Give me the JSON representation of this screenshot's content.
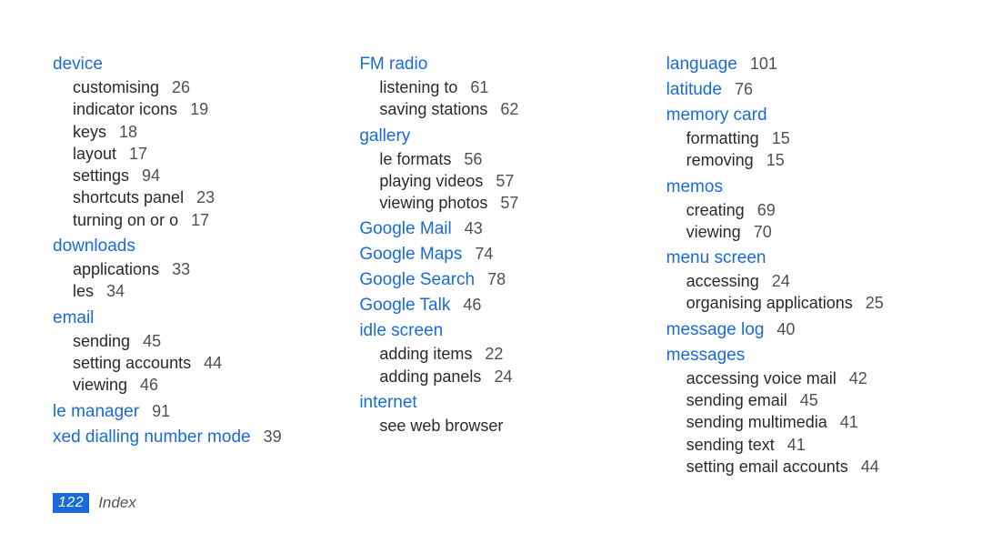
{
  "footer": {
    "page": "122",
    "label": "Index"
  },
  "columns": [
    {
      "entries": [
        {
          "heading": "device",
          "page": null,
          "sub": [
            {
              "label": "customising",
              "page": "26"
            },
            {
              "label": "indicator icons",
              "page": "19"
            },
            {
              "label": "keys",
              "page": "18"
            },
            {
              "label": "layout",
              "page": "17"
            },
            {
              "label": "settings",
              "page": "94"
            },
            {
              "label": "shortcuts panel",
              "page": "23"
            },
            {
              "label": "turning on or o",
              "page": "17"
            }
          ]
        },
        {
          "heading": "downloads",
          "page": null,
          "sub": [
            {
              "label": "applications",
              "page": "33"
            },
            {
              "label": "les",
              "page": "34"
            }
          ]
        },
        {
          "heading": "email",
          "page": null,
          "sub": [
            {
              "label": "sending",
              "page": "45"
            },
            {
              "label": "setting accounts",
              "page": "44"
            },
            {
              "label": "viewing",
              "page": "46"
            }
          ]
        },
        {
          "heading": "le manager",
          "page": "91",
          "sub": []
        },
        {
          "heading": "xed dialling number mode",
          "page": "39",
          "sub": []
        }
      ]
    },
    {
      "entries": [
        {
          "heading": "FM radio",
          "page": null,
          "sub": [
            {
              "label": "listening to",
              "page": "61"
            },
            {
              "label": "saving stations",
              "page": "62"
            }
          ]
        },
        {
          "heading": "gallery",
          "page": null,
          "sub": [
            {
              "label": "le formats",
              "page": "56"
            },
            {
              "label": "playing videos",
              "page": "57"
            },
            {
              "label": "viewing photos",
              "page": "57"
            }
          ]
        },
        {
          "heading": "Google Mail",
          "page": "43",
          "sub": []
        },
        {
          "heading": "Google Maps",
          "page": "74",
          "sub": []
        },
        {
          "heading": "Google Search",
          "page": "78",
          "sub": []
        },
        {
          "heading": "Google Talk",
          "page": "46",
          "sub": []
        },
        {
          "heading": "idle screen",
          "page": null,
          "sub": [
            {
              "label": "adding items",
              "page": "22"
            },
            {
              "label": "adding panels",
              "page": "24"
            }
          ]
        },
        {
          "heading": "internet",
          "page": null,
          "sub": [
            {
              "label": "see web browser",
              "page": null
            }
          ]
        }
      ]
    },
    {
      "entries": [
        {
          "heading": "language",
          "page": "101",
          "sub": []
        },
        {
          "heading": "latitude",
          "page": "76",
          "sub": []
        },
        {
          "heading": "memory card",
          "page": null,
          "sub": [
            {
              "label": "formatting",
              "page": "15"
            },
            {
              "label": "removing",
              "page": "15"
            }
          ]
        },
        {
          "heading": "memos",
          "page": null,
          "sub": [
            {
              "label": "creating",
              "page": "69"
            },
            {
              "label": "viewing",
              "page": "70"
            }
          ]
        },
        {
          "heading": "menu screen",
          "page": null,
          "sub": [
            {
              "label": "accessing",
              "page": "24"
            },
            {
              "label": "organising applications",
              "page": "25"
            }
          ]
        },
        {
          "heading": "message log",
          "page": "40",
          "sub": []
        },
        {
          "heading": "messages",
          "page": null,
          "sub": [
            {
              "label": "accessing voice mail",
              "page": "42"
            },
            {
              "label": "sending email",
              "page": "45"
            },
            {
              "label": "sending multimedia",
              "page": "41"
            },
            {
              "label": "sending text",
              "page": "41"
            },
            {
              "label": "setting email accounts",
              "page": "44"
            }
          ]
        }
      ]
    }
  ]
}
